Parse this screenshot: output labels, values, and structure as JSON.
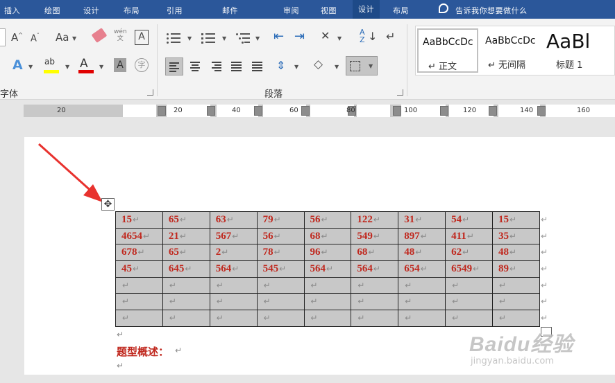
{
  "tabs": [
    {
      "label": "插入"
    },
    {
      "label": "绘图"
    },
    {
      "label": "设计"
    },
    {
      "label": "布局"
    },
    {
      "label": "引用"
    },
    {
      "label": "邮件"
    },
    {
      "label": "审阅"
    },
    {
      "label": "视图"
    },
    {
      "label": "设计"
    },
    {
      "label": "布局"
    },
    {
      "label": "告诉我你想要做什么"
    }
  ],
  "ribbon": {
    "font_group_label": "字体",
    "paragraph_group_label": "段落",
    "wen_icon": "wén\n文",
    "styles": [
      {
        "sample": "AaBbCcDc",
        "name": "正文"
      },
      {
        "sample": "AaBbCcDc",
        "name": "无间隔"
      },
      {
        "sample": "AaBl",
        "name": "标题 1"
      }
    ]
  },
  "ruler": {
    "numbers": [
      "20",
      "20",
      "40",
      "60",
      "80",
      "100",
      "120",
      "140",
      "160"
    ]
  },
  "table": {
    "rows": [
      [
        "15",
        "65",
        "63",
        "79",
        "56",
        "122",
        "31",
        "54",
        "15"
      ],
      [
        "4654",
        "21",
        "567",
        "56",
        "68",
        "549",
        "897",
        "411",
        "35"
      ],
      [
        "678",
        "65",
        "2",
        "78",
        "96",
        "68",
        "48",
        "62",
        "48"
      ],
      [
        "45",
        "645",
        "564",
        "545",
        "564",
        "564",
        "654",
        "6549",
        "89"
      ],
      [
        "",
        "",
        "",
        "",
        "",
        "",
        "",
        "",
        ""
      ],
      [
        "",
        "",
        "",
        "",
        "",
        "",
        "",
        "",
        ""
      ],
      [
        "",
        "",
        "",
        "",
        "",
        "",
        "",
        "",
        ""
      ]
    ]
  },
  "document": {
    "heading": "题型概述：",
    "para_mark": "↵"
  },
  "watermark": {
    "logo": "Baidu经验",
    "url": "jingyan.baidu.com"
  },
  "colors": {
    "title_bar": "#2b579a",
    "table_text": "#c0281e",
    "cell_fill": "#c8c8c8",
    "arrow": "#e8322e"
  }
}
